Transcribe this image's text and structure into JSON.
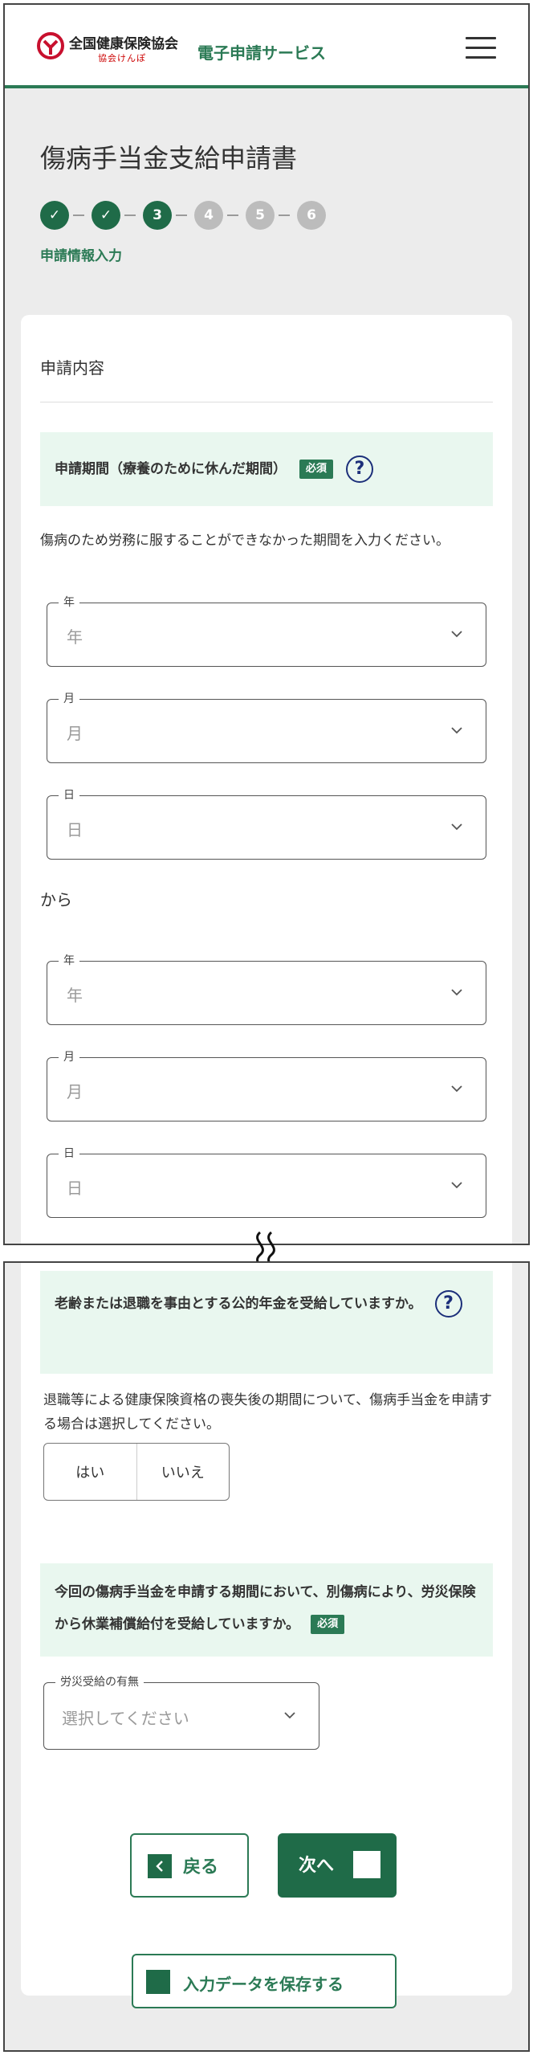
{
  "header": {
    "org_name": "全国健康保険協会",
    "org_sub": "協会けんぽ",
    "service": "電子申請サービス"
  },
  "page": {
    "title": "傷病手当金支給申請書",
    "step_label": "申請情報入力"
  },
  "steps": [
    {
      "label": "✓",
      "state": "done"
    },
    {
      "label": "✓",
      "state": "done"
    },
    {
      "label": "3",
      "state": "current"
    },
    {
      "label": "4",
      "state": "todo"
    },
    {
      "label": "5",
      "state": "todo"
    },
    {
      "label": "6",
      "state": "todo"
    }
  ],
  "section": {
    "title": "申請内容"
  },
  "period": {
    "question": "申請期間（療養のために休んだ期間）",
    "required": "必須",
    "help": "?",
    "description": "傷病のため労務に服することができなかった期間を入力ください。",
    "from_fields": [
      {
        "legend": "年",
        "placeholder": "年"
      },
      {
        "legend": "月",
        "placeholder": "月"
      },
      {
        "legend": "日",
        "placeholder": "日"
      }
    ],
    "kara": "から",
    "to_fields": [
      {
        "legend": "年",
        "placeholder": "年"
      },
      {
        "legend": "月",
        "placeholder": "月"
      },
      {
        "legend": "日",
        "placeholder": "日"
      }
    ]
  },
  "pension": {
    "question_line1": "老齢または退職を事由とする公的年金を受給していますか。",
    "help": "?",
    "description": "退職等による健康保険資格の喪失後の期間について、傷病手当金を申請する場合は選択してください。",
    "yes": "はい",
    "no": "いいえ"
  },
  "workers_comp": {
    "question": "今回の傷病手当金を申請する期間において、別傷病により、労災保険から休業補償給付を受給していますか。",
    "required": "必須",
    "legend": "労災受給の有無",
    "placeholder": "選択してください"
  },
  "buttons": {
    "back": "戻る",
    "next": "次へ",
    "save": "入力データを保存する"
  },
  "colors": {
    "brand_green": "#2b7a55",
    "dark_green": "#1f6b48",
    "question_bg": "#e9f7ef",
    "help_blue": "#1c2f7a"
  }
}
